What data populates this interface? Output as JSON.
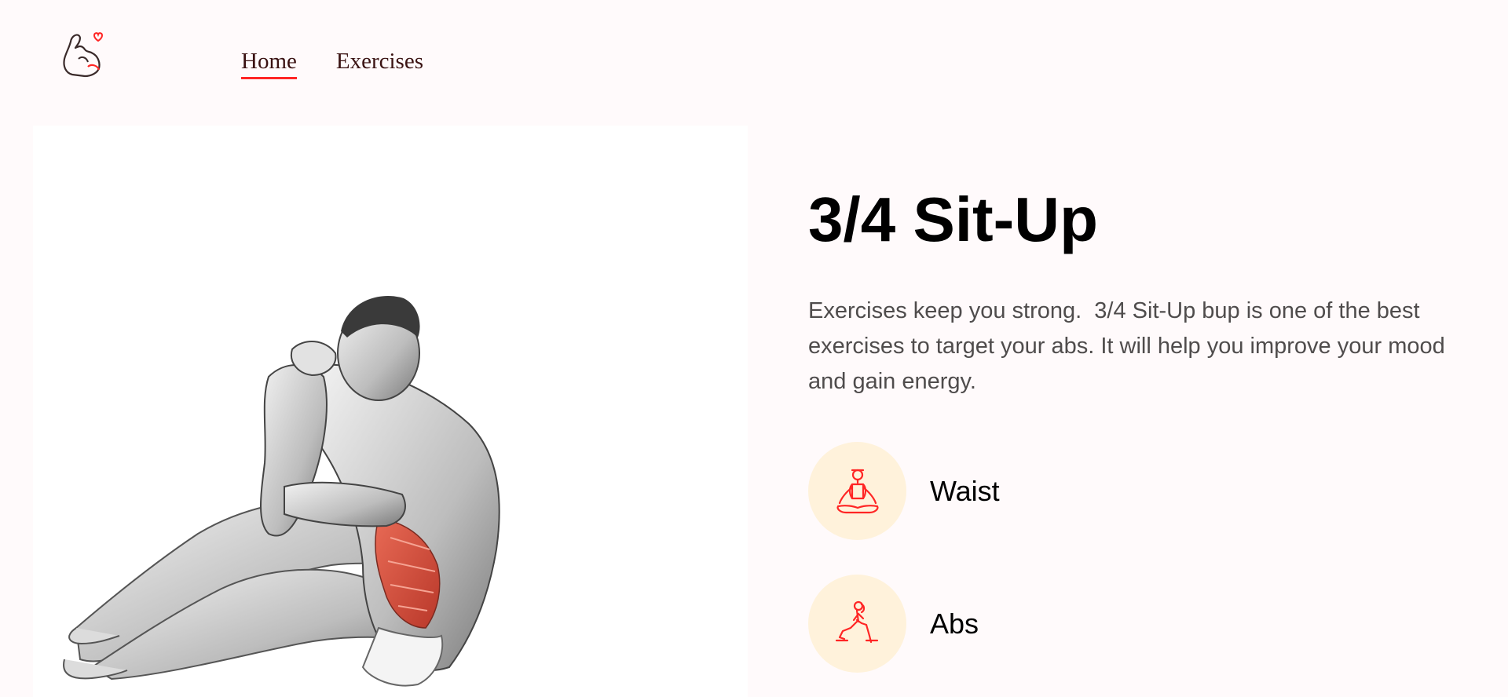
{
  "nav": {
    "logo_icon": "flexed-bicep-heart-icon",
    "links": [
      {
        "label": "Home",
        "active": true
      },
      {
        "label": "Exercises",
        "active": false
      }
    ]
  },
  "exercise": {
    "image_icon": "sit-up-figure-illustration",
    "title": "3/4 Sit-Up",
    "description": "Exercises keep you strong.  3/4 Sit-Up bup is one of the best exercises to target your abs. It will help you improve your mood and gain energy.",
    "details": [
      {
        "icon": "meditation-pose-icon",
        "label": "Waist"
      },
      {
        "icon": "lunge-pose-icon",
        "label": "Abs"
      }
    ]
  },
  "colors": {
    "accent": "#ff2625",
    "background": "#fffafb",
    "tag_bg": "#fff2db",
    "muscle_highlight": "#e06b55"
  }
}
